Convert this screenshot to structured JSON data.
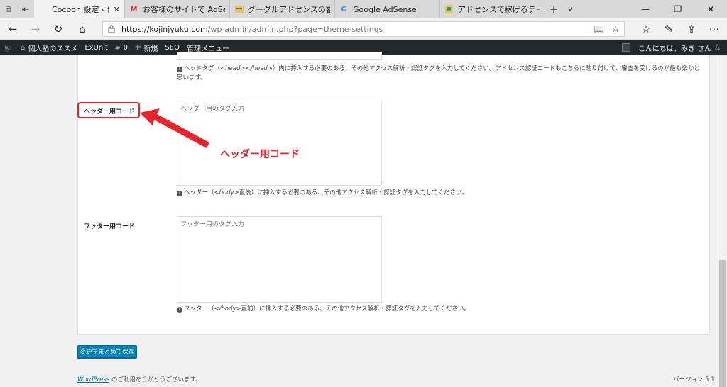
{
  "browser": {
    "tabs": [
      {
        "title": "Cocoon 設定 ‹ 個人塾の",
        "favicon": "wordpress-icon",
        "active": true
      },
      {
        "title": "お客様のサイトで AdSense 広",
        "favicon": "gmail-icon",
        "active": false
      },
      {
        "title": "グーグルアドセンスの審査を通過",
        "favicon": "site-icon",
        "active": false
      },
      {
        "title": "Google AdSense",
        "favicon": "google-icon",
        "active": false
      },
      {
        "title": "アドセンスで稼げるテーマ【Coco",
        "favicon": "site-icon",
        "active": false
      }
    ],
    "url_host": "https://kojinjyuku.com",
    "url_rest": "/wp-admin/admin.php?page=theme-settings"
  },
  "adminbar": {
    "site_name": "個人塾のススメ",
    "exunit": "ExUnit",
    "comments_count": "0",
    "new_label": "新規",
    "seo_label": "SEO",
    "manage_menu": "管理メニュー",
    "greeting": "こんにちは、みき さん"
  },
  "settings": {
    "head_desc_prefix": "ヘッドタグ（",
    "head_desc_code": "<head></head>",
    "head_desc_suffix": "）内に挿入する必要のある、その他アクセス解析・認証タグを入力してください。アドセンス認証コードもこちらに貼り付けて、審査を受けるのが最も楽かと思います。",
    "header_label": "ヘッダー用コード",
    "header_placeholder": "ヘッダー用のタグ入力",
    "header_desc_prefix": "ヘッダー（",
    "header_desc_code": "<body>",
    "header_desc_suffix": "直後）に挿入する必要のある、その他アクセス解析・認証タグを入力してください。",
    "footer_label": "フッター用コード",
    "footer_placeholder": "フッター用のタグ入力",
    "footer_desc_prefix": "フッター（",
    "footer_desc_code": "</body>",
    "footer_desc_suffix": "直前）に挿入する必要のある、その他アクセス解析・認証タグを入力してください。"
  },
  "annotation": {
    "callout_text": "ヘッダー用コード",
    "color": "#e8242a"
  },
  "save_button": "変更をまとめて保存",
  "footer": {
    "wordpress_link": "WordPress",
    "thanks": " のご利用ありがとうございます。",
    "version": "バージョン 5.1"
  },
  "colors": {
    "adminbar_bg": "#23282d",
    "primary_button": "#0085ba",
    "link": "#0073aa"
  }
}
